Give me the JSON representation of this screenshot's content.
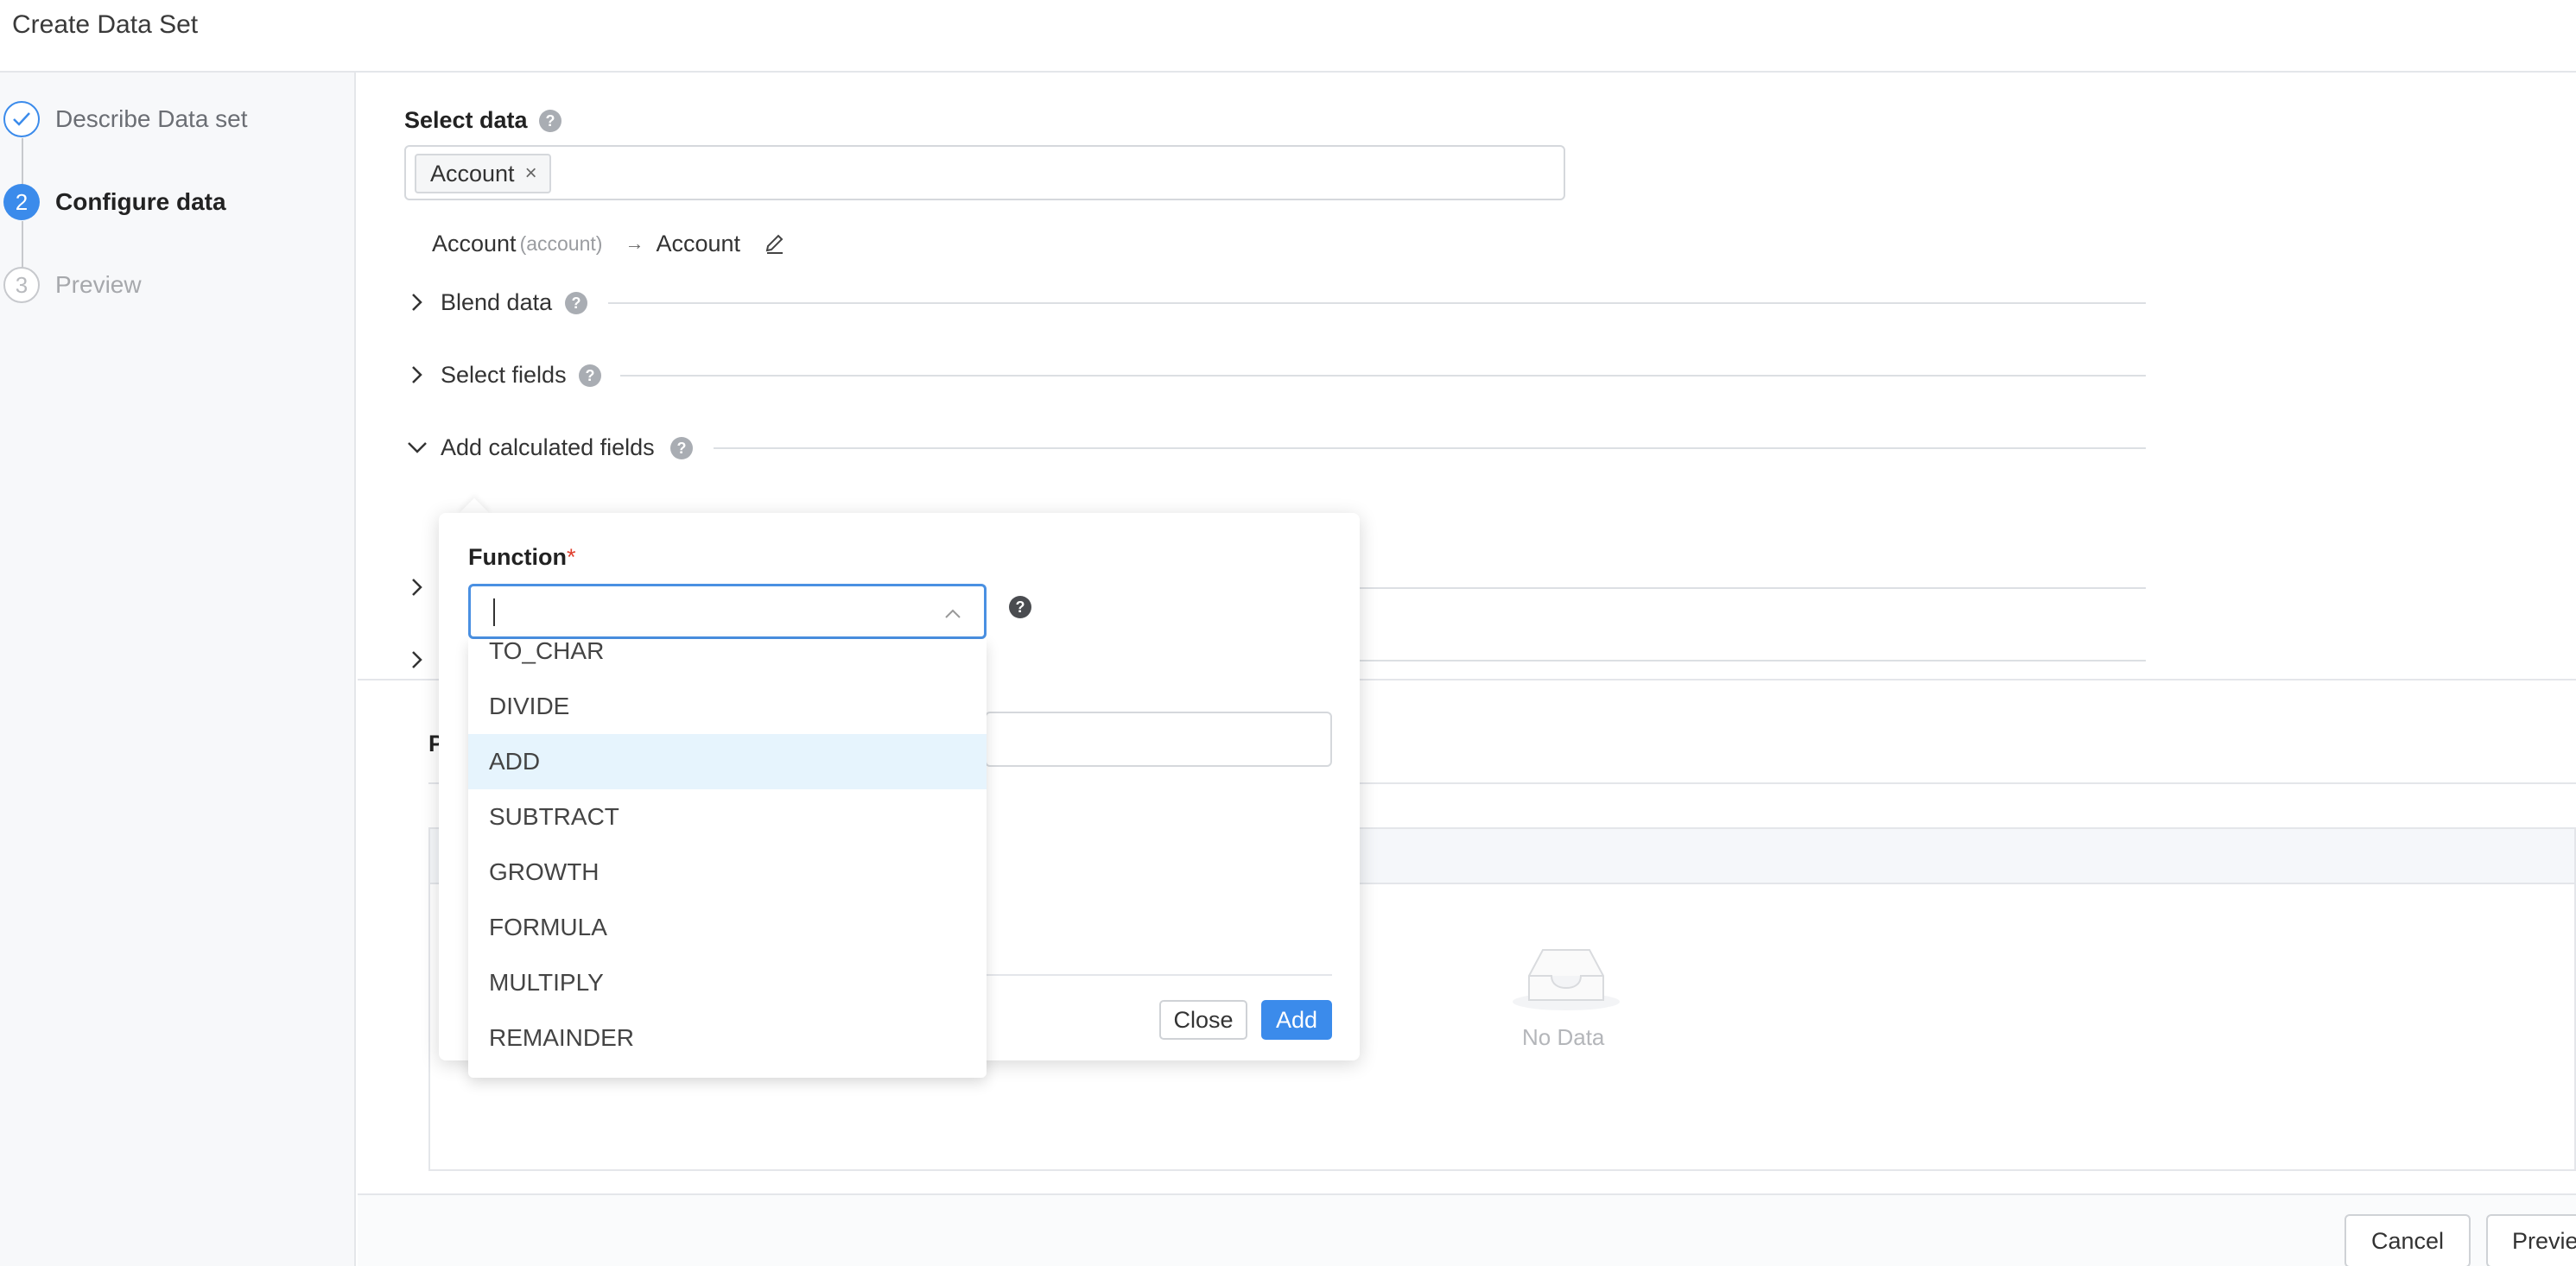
{
  "header": {
    "title": "Create Data Set"
  },
  "steps": [
    {
      "number": "",
      "label": "Describe Data set",
      "state": "done"
    },
    {
      "number": "2",
      "label": "Configure data",
      "state": "active"
    },
    {
      "number": "3",
      "label": "Preview",
      "state": "pending"
    }
  ],
  "select_data": {
    "label": "Select data",
    "tag": "Account",
    "tag_close": "×"
  },
  "mapping": {
    "source": "Account",
    "source_sub": "(account)",
    "arrow": "→",
    "target": "Account"
  },
  "sections": {
    "blend": "Blend data",
    "select_fields": "Select fields",
    "calculated": "Add calculated fields"
  },
  "popup": {
    "function_label": "Function",
    "required_mark": "*",
    "input_value": "",
    "close_label": "Close",
    "add_label": "Add"
  },
  "dropdown": {
    "options": [
      "TO_CHAR",
      "DIVIDE",
      "ADD",
      "SUBTRACT",
      "GROWTH",
      "FORMULA",
      "MULTIPLY",
      "REMAINDER"
    ],
    "highlighted": "ADD"
  },
  "preview": {
    "heading_visible": "P",
    "empty_text": "No Data"
  },
  "footer": {
    "cancel_label": "Cancel",
    "preview_label": "Previe"
  },
  "colors": {
    "accent": "#3b8beb",
    "highlight": "#e6f4fd",
    "required": "#e0402f"
  }
}
